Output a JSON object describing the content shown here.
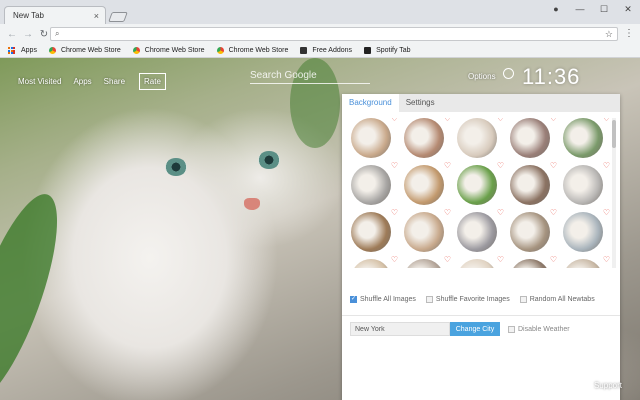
{
  "browser": {
    "tab_title": "New Tab",
    "tab_close": "×",
    "window_controls": [
      "●",
      "—",
      "☐",
      "✕"
    ],
    "omnibox_value": "",
    "bookmarks": [
      {
        "label": "Apps",
        "icon": "apps-grid-icon"
      },
      {
        "label": "Chrome Web Store",
        "icon": "chrome-web-store-icon"
      },
      {
        "label": "Chrome Web Store",
        "icon": "chrome-web-store-icon"
      },
      {
        "label": "Chrome Web Store",
        "icon": "chrome-web-store-icon"
      },
      {
        "label": "Free Addons",
        "icon": "free-addons-icon"
      },
      {
        "label": "Spotify Tab",
        "icon": "spotify-tab-icon"
      }
    ]
  },
  "page": {
    "nav": [
      "Most Visited",
      "Apps",
      "Share",
      "Rate"
    ],
    "search_placeholder": "Search Google",
    "options_label": "Options",
    "clock": "11:36",
    "support_label": "Support"
  },
  "panel": {
    "tabs": [
      "Background",
      "Settings"
    ],
    "thumbnail_colors": [
      "#c9a98b",
      "#b58a72",
      "#d8cbbd",
      "#9a7f78",
      "#7a9a6a",
      "#a8a6a4",
      "#c39a6e",
      "#6aa04a",
      "#8b7262",
      "#b9b7b5",
      "#9e7b58",
      "#c8a98c",
      "#9c9aa0",
      "#a69480",
      "#a9b4bc",
      "#d6c2a8",
      "#b5a69a",
      "#e1d3c2",
      "#8e7a6a",
      "#c9b9a6"
    ],
    "options": [
      {
        "label": "Shuffle All Images",
        "checked": true
      },
      {
        "label": "Shuffle Favorite Images",
        "checked": false
      },
      {
        "label": "Random All Newtabs",
        "checked": false
      }
    ],
    "city_value": "New York",
    "change_city_label": "Change City",
    "disable_weather_label": "Disable Weather"
  },
  "colors": {
    "accent": "#4a90d9",
    "button": "#4aa3df",
    "heart": "#e75a4f"
  }
}
